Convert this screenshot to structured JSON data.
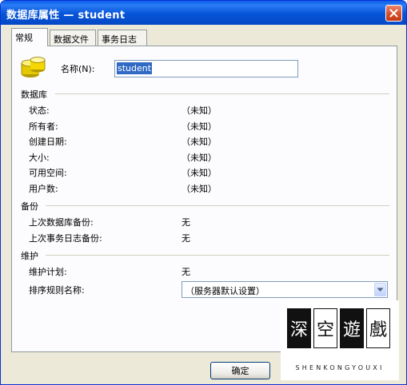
{
  "window": {
    "title": "数据库属性 — student",
    "colors": {
      "titlebar": "#0a5ee8",
      "dialog_bg": "#ece9d8",
      "close": "#d54a24"
    }
  },
  "tabs": [
    {
      "label": "常规",
      "active": true
    },
    {
      "label": "数据文件",
      "active": false
    },
    {
      "label": "事务日志",
      "active": false
    }
  ],
  "general": {
    "db_icon": "database-icon",
    "name_label": "名称(N):",
    "name_value": "student"
  },
  "database": {
    "heading": "数据库",
    "fields": [
      {
        "label": "状态:",
        "value": "（未知）"
      },
      {
        "label": "所有者:",
        "value": "（未知）"
      },
      {
        "label": "创建日期:",
        "value": "（未知）"
      },
      {
        "label": "大小:",
        "value": "（未知）"
      },
      {
        "label": "可用空间:",
        "value": "（未知）"
      },
      {
        "label": "用户数:",
        "value": "（未知）"
      }
    ]
  },
  "backup": {
    "heading": "备份",
    "fields": [
      {
        "label": "上次数据库备份:",
        "value": "无"
      },
      {
        "label": "上次事务日志备份:",
        "value": "无"
      }
    ]
  },
  "maintenance": {
    "heading": "维护",
    "plan_label": "维护计划:",
    "plan_value": "无",
    "collation_label": "排序规则名称:",
    "collation_value": "（服务器默认设置）"
  },
  "buttons": {
    "ok": "确定"
  },
  "watermark": {
    "chars": [
      "深",
      "空",
      "遊",
      "戲"
    ],
    "subtitle": "SHENKONGYOUXI"
  }
}
